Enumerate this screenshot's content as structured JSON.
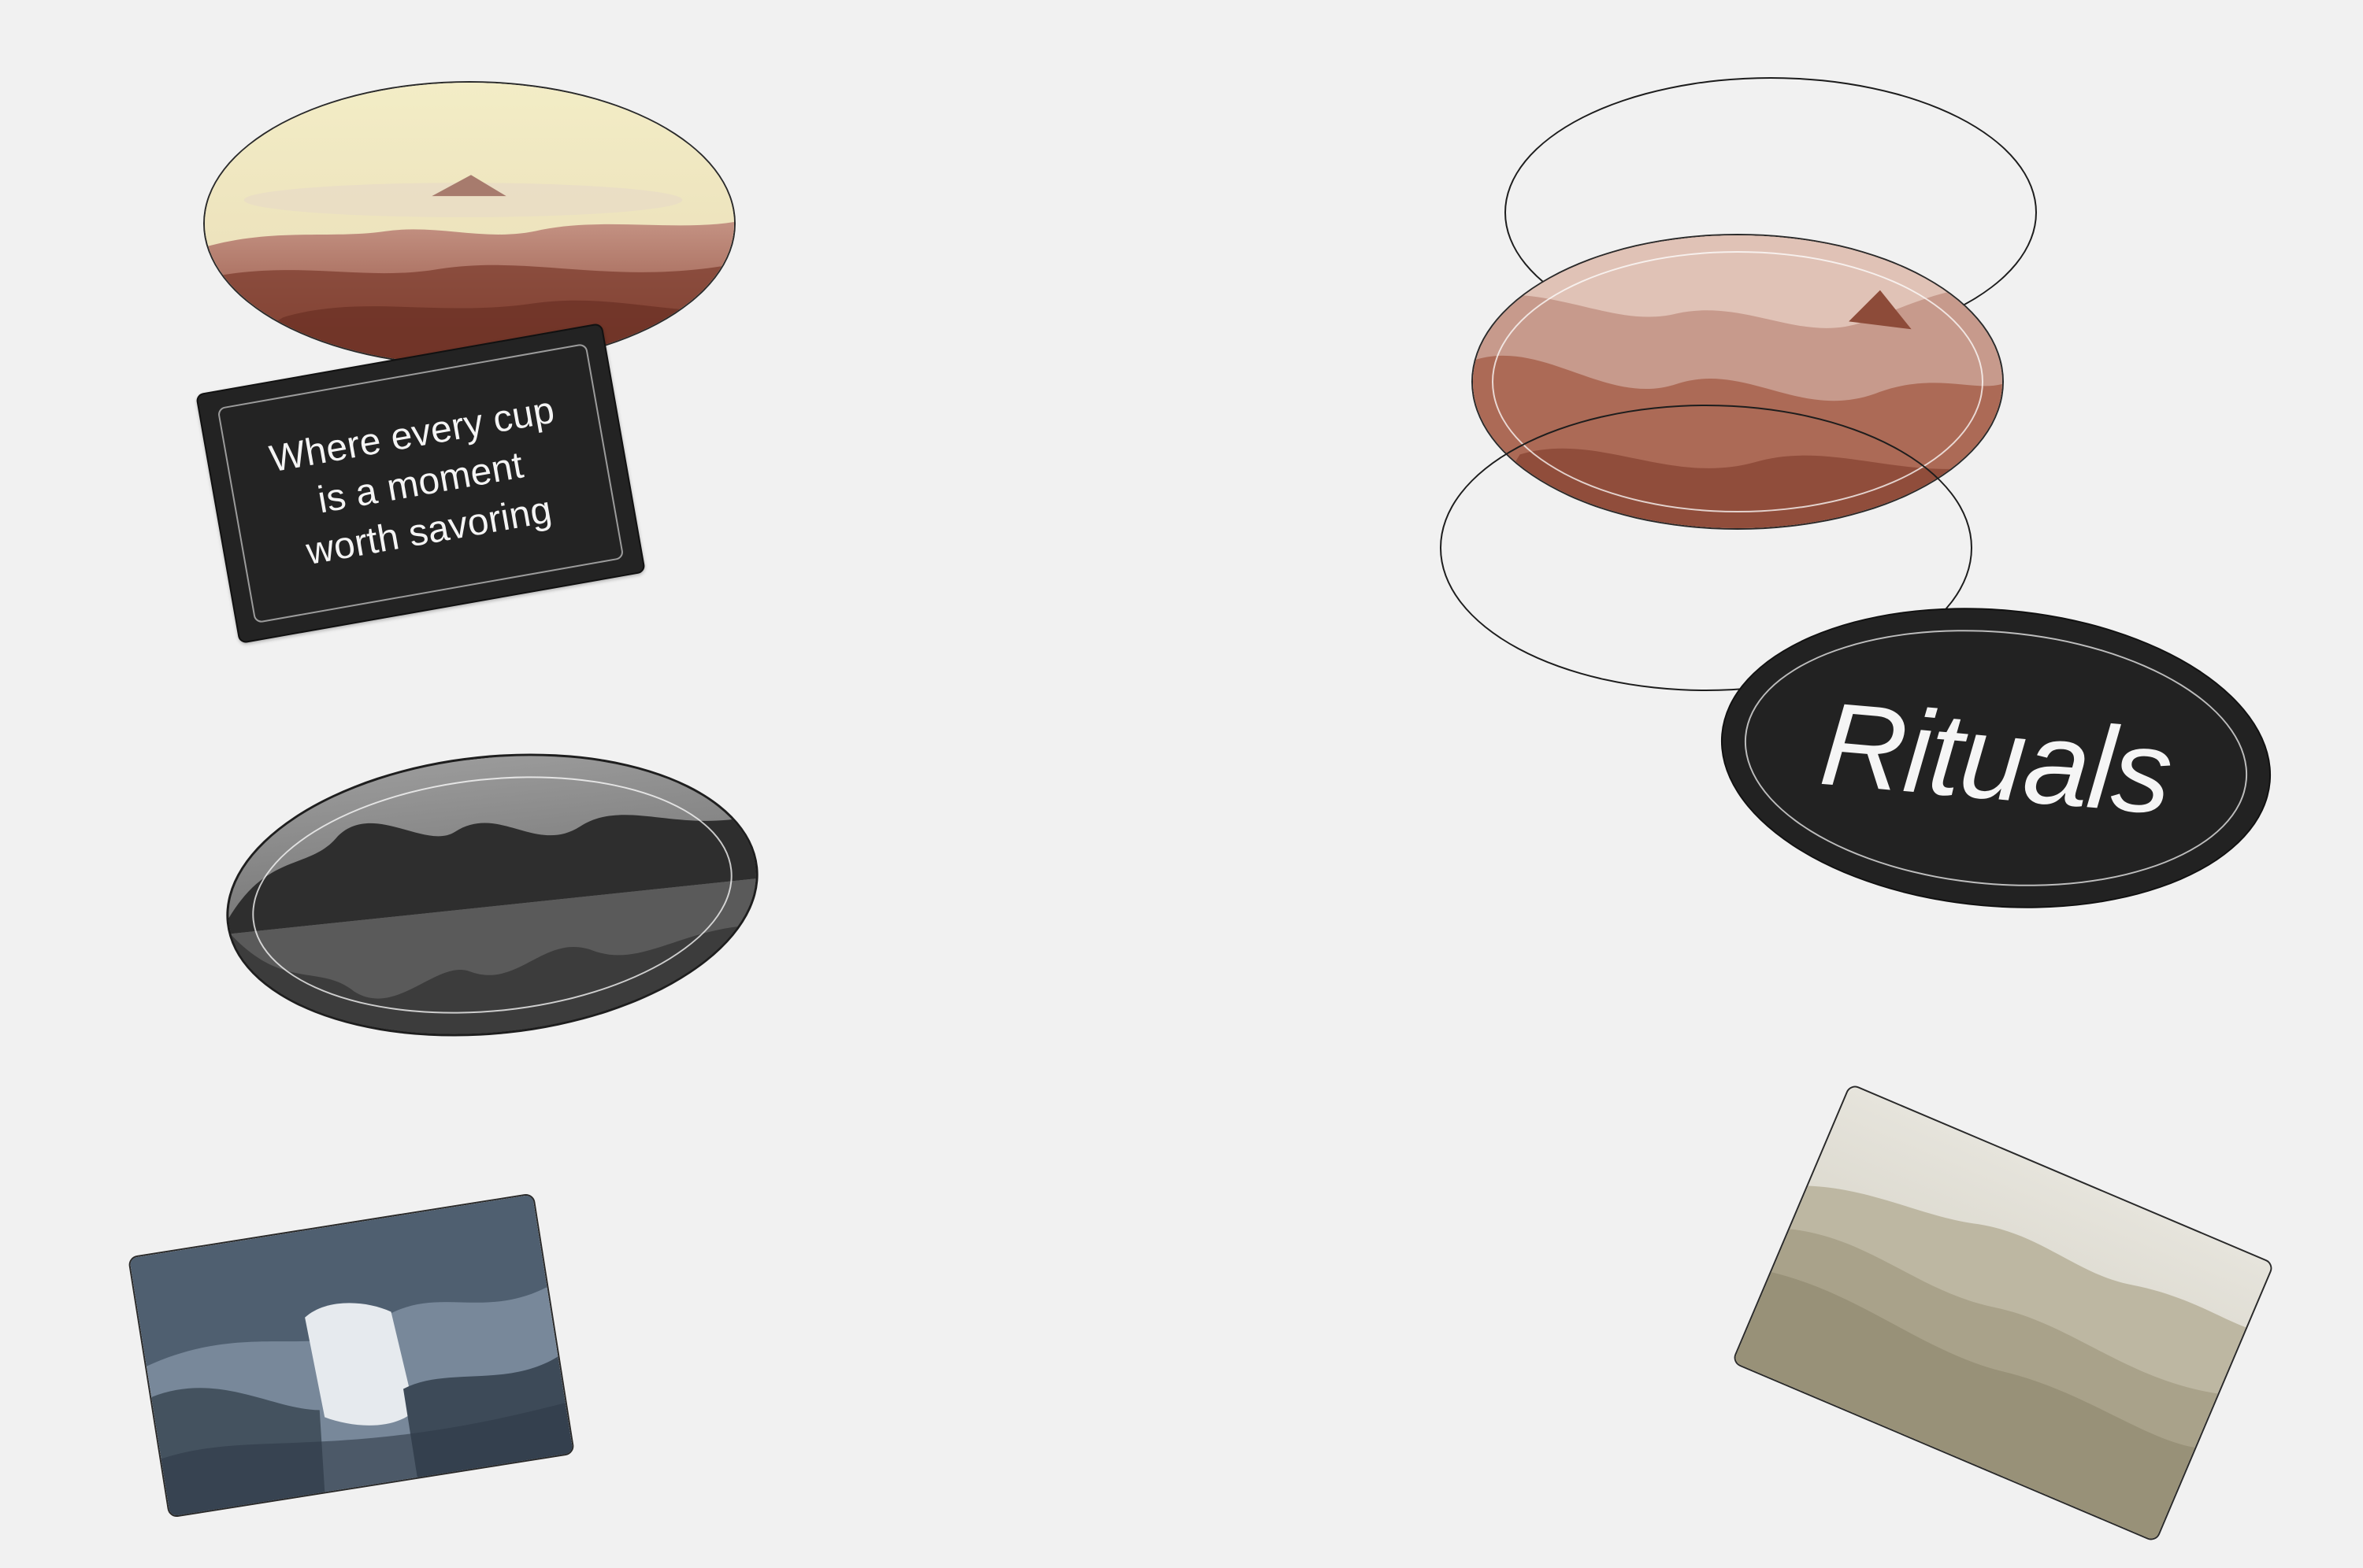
{
  "quote": {
    "lines": [
      "Where every cup",
      "is a moment",
      "worth savoring"
    ]
  },
  "badge": {
    "title": "Rituals"
  },
  "images": [
    {
      "name": "mountain-sunrise-sepia-ellipse",
      "tone": "sepia"
    },
    {
      "name": "forest-lake-grayscale-ellipse",
      "tone": "grayscale"
    },
    {
      "name": "waterfall-jungle-bluegray-card",
      "tone": "blue-gray"
    },
    {
      "name": "canyon-rust-ellipse",
      "tone": "rust"
    },
    {
      "name": "hills-khaki-card",
      "tone": "khaki"
    }
  ],
  "colors": {
    "background": "#f1f1f1",
    "dark": "#222222",
    "sepia_light": "#f0e8bf",
    "rust": "#9a5440",
    "slate": "#6c7b8a",
    "khaki": "#b3ad97"
  }
}
